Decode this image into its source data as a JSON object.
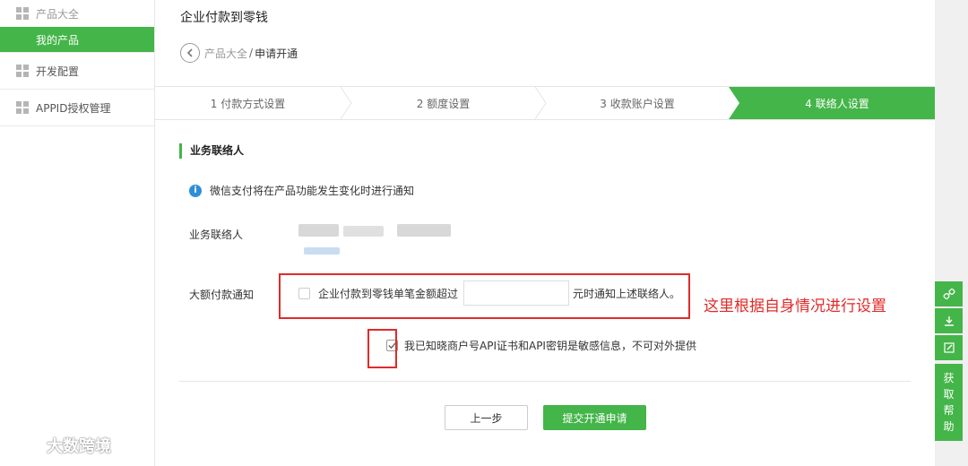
{
  "sidebar": {
    "group_products": "产品大全",
    "my_products": "我的产品",
    "dev_config": "开发配置",
    "appid_auth": "APPID授权管理"
  },
  "watermark": "大数跨境",
  "page": {
    "title": "企业付款到零钱",
    "breadcrumb": {
      "parent": "产品大全",
      "sep": "/",
      "current": "申请开通"
    }
  },
  "steps": [
    {
      "label": "1 付款方式设置",
      "active": false
    },
    {
      "label": "2 额度设置",
      "active": false
    },
    {
      "label": "3 收款账户设置",
      "active": false
    },
    {
      "label": "4 联络人设置",
      "active": true
    }
  ],
  "section": {
    "title": "业务联络人",
    "tip": "微信支付将在产品功能发生变化时进行通知",
    "contact_label": "业务联络人",
    "large_payment_label": "大额付款通知",
    "large_payment_prefix": "企业付款到零钱单笔金额超过",
    "large_payment_value": "",
    "large_payment_suffix": "元时通知上述联络人。",
    "ack_text": "我已知晓商户号API证书和API密钥是敏感信息，不可对外提供",
    "ack_checked": true,
    "annotation": "这里根据自身情况进行设置"
  },
  "buttons": {
    "prev": "上一步",
    "submit": "提交开通申请"
  },
  "rail": {
    "help": [
      "获",
      "取",
      "帮",
      "助"
    ]
  },
  "colors": {
    "accent": "#44b549",
    "annotation": "#e02b2b",
    "info": "#2e8fd8"
  }
}
